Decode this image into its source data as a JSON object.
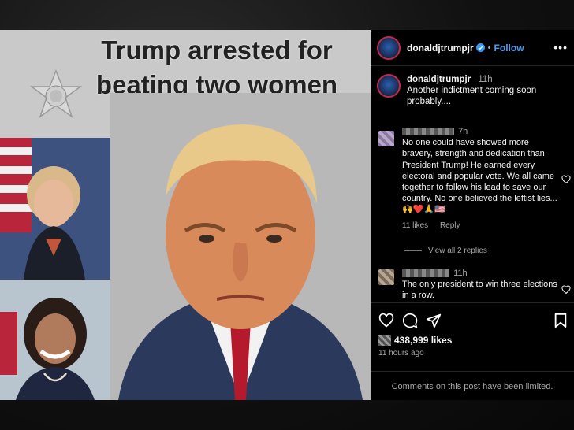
{
  "media": {
    "headline_line1": "Trump arrested for",
    "headline_line2": "beating two women"
  },
  "header": {
    "username": "donaldjtrumpjr",
    "separator": "•",
    "follow_label": "Follow",
    "more_label": "•••"
  },
  "caption": {
    "username": "donaldjtrumpjr",
    "time": "11h",
    "text": "Another indictment coming soon probably...."
  },
  "comments": [
    {
      "time": "7h",
      "text": "No one could have showed more bravery, strength and dedication than President Trump! He earned every electoral and popular vote. We all came together to follow his lead to save our country. No one believed the leftist lies...🙌❤️🙏🇺🇸",
      "likes": "11 likes",
      "reply": "Reply"
    },
    {
      "time": "11h",
      "text": "The only president to win three elections in a row."
    }
  ],
  "view_replies": "View all 2 replies",
  "stats": {
    "likes": "438,999 likes",
    "ago": "11 hours ago"
  },
  "footer": {
    "limited": "Comments on this post have been limited."
  },
  "colors": {
    "accent_blue": "#4a9cf2",
    "text_gray": "#a8a8a8",
    "tie_red": "#b5192c"
  }
}
